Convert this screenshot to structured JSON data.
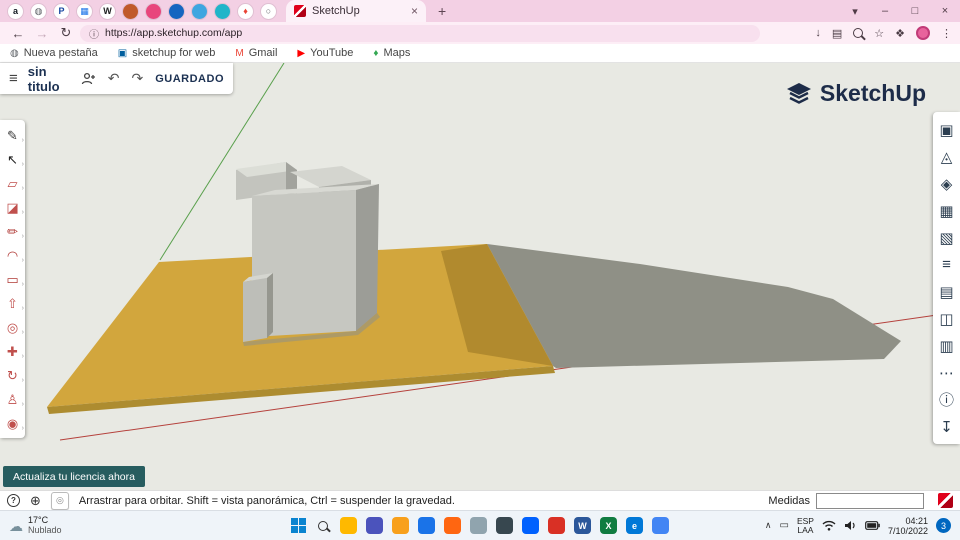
{
  "colors": {
    "canvas_bg": "#e8e9e3",
    "ground": "#d2a63d",
    "ground_edge": "#ad8c30",
    "ground_shadow": "#b18a2e",
    "cast_shadow": "#8f9086",
    "axis_green": "#59a04c",
    "axis_red": "#b5413c",
    "building_front": "#c6c7c1",
    "building_side": "#9c9d97",
    "building_top": "#d8d9d3",
    "brand_navy": "#1d2c49",
    "accent_red": "#e0001b",
    "license_teal": "#275d5f",
    "chrome_pink": "#f3d0e4"
  },
  "browser": {
    "window": {
      "tab_search": "▾",
      "minimize": "–",
      "maximize": "□",
      "close": "×"
    },
    "tabs": {
      "active_label": "SketchUp",
      "close": "×",
      "new_tab": "+"
    },
    "pinned_tabs": [
      {
        "name": "pinned-tab-amazon",
        "bg": "#ffffff",
        "fg": "#131921",
        "glyph": "a"
      },
      {
        "name": "pinned-tab-globe",
        "bg": "#ffffff",
        "fg": "#5f6368",
        "glyph": "◍"
      },
      {
        "name": "pinned-tab-paypal",
        "bg": "#ffffff",
        "fg": "#1546a0",
        "glyph": "P"
      },
      {
        "name": "pinned-tab-blue-grid",
        "bg": "#ffffff",
        "fg": "#1a73e8",
        "glyph": "▦"
      },
      {
        "name": "pinned-tab-wiki",
        "bg": "#ffffff",
        "fg": "#202122",
        "glyph": "W"
      },
      {
        "name": "pinned-tab-orange",
        "bg": "#c05a2a",
        "fg": "#ffffff",
        "glyph": ""
      },
      {
        "name": "pinned-tab-pink",
        "bg": "#e8467c",
        "fg": "#ffffff",
        "glyph": ""
      },
      {
        "name": "pinned-tab-blue-square",
        "bg": "#1565c0",
        "fg": "#ffffff",
        "glyph": ""
      },
      {
        "name": "pinned-tab-skyblue",
        "bg": "#3ea6e0",
        "fg": "#ffffff",
        "glyph": ""
      },
      {
        "name": "pinned-tab-teal",
        "bg": "#20b5c9",
        "fg": "#ffffff",
        "glyph": ""
      },
      {
        "name": "pinned-tab-maps",
        "bg": "#ffffff",
        "fg": "#ea4335",
        "glyph": "♦"
      },
      {
        "name": "pinned-tab-ring",
        "bg": "#ffffff",
        "fg": "#5f6368",
        "glyph": "○"
      }
    ],
    "address": {
      "back": "←",
      "forward": "→",
      "reload": "↻",
      "info": "ⓘ",
      "url": "https://app.sketchup.com/app",
      "install": "↓",
      "panel": "▤",
      "star": "☆",
      "puzzle": "❖",
      "menu": "⋮"
    },
    "bookmarks": [
      {
        "name": "bookmark-new-tab",
        "label": "Nueva pestaña",
        "glyph": "◍",
        "color": "#5f6368"
      },
      {
        "name": "bookmark-sketchup-web",
        "label": "sketchup for web",
        "glyph": "▣",
        "color": "#005f9e"
      },
      {
        "name": "bookmark-gmail",
        "label": "Gmail",
        "glyph": "M",
        "color": "#ea4335"
      },
      {
        "name": "bookmark-youtube",
        "label": "YouTube",
        "glyph": "▶",
        "color": "#ff0000"
      },
      {
        "name": "bookmark-maps",
        "label": "Maps",
        "glyph": "♦",
        "color": "#34a853"
      }
    ]
  },
  "app": {
    "menu_glyph": "≡",
    "title": "sin titulo",
    "undo_glyph": "↶",
    "redo_glyph": "↷",
    "saved_label": "GUARDADO",
    "brand": "SketchUp",
    "flyout_glyph": "›",
    "license_button_label": "Actualiza tu licencia ahora",
    "status_hint": "Arrastrar para orbitar. Shift = vista panorámica, Ctrl = suspender la gravedad.",
    "help_glyph": "?",
    "language_glyph": "⊕",
    "geo_glyph": "◎",
    "measures_label": "Medidas",
    "measures_value": "",
    "left_tools": [
      {
        "name": "freehand-tool",
        "glyph": "✎",
        "color": "#333333"
      },
      {
        "name": "select-tool",
        "glyph": "↖",
        "color": "#222222"
      },
      {
        "name": "eraser-tool",
        "glyph": "▱",
        "color": "#c0504d"
      },
      {
        "name": "paint-tool",
        "glyph": "◪",
        "color": "#c0504d"
      },
      {
        "name": "pencil-tool",
        "glyph": "✏",
        "color": "#b03a36"
      },
      {
        "name": "arc-tool",
        "glyph": "◠",
        "color": "#b03a36"
      },
      {
        "name": "rectangle-tool",
        "glyph": "▭",
        "color": "#b03a36"
      },
      {
        "name": "pushpull-tool",
        "glyph": "⇧",
        "color": "#c0504d"
      },
      {
        "name": "offset-tool",
        "glyph": "◎",
        "color": "#c0504d"
      },
      {
        "name": "move-tool",
        "glyph": "✚",
        "color": "#c0504d"
      },
      {
        "name": "rotate-tool",
        "glyph": "↻",
        "color": "#c0504d"
      },
      {
        "name": "walk-tool",
        "glyph": "♙",
        "color": "#c0504d"
      },
      {
        "name": "orbit-tool",
        "glyph": "◉",
        "color": "#c0504d"
      }
    ],
    "right_tools": [
      {
        "name": "entity-info-panel",
        "glyph": "▣"
      },
      {
        "name": "instructor-panel",
        "glyph": "◬"
      },
      {
        "name": "components-panel",
        "glyph": "◈"
      },
      {
        "name": "materials-panel",
        "glyph": "▦"
      },
      {
        "name": "styles-panel",
        "glyph": "▧"
      },
      {
        "name": "layers-panel",
        "glyph": "≡"
      },
      {
        "name": "scenes-panel",
        "glyph": "▤"
      },
      {
        "name": "views-panel",
        "glyph": "◫"
      },
      {
        "name": "display-panel",
        "glyph": "▥"
      },
      {
        "name": "soften-edges-panel",
        "glyph": "⋯"
      },
      {
        "name": "model-info-panel",
        "glyph": "ⓘ"
      },
      {
        "name": "download-panel",
        "glyph": "↧"
      }
    ]
  },
  "taskbar": {
    "weather": {
      "icon": "☁",
      "temp": "17°C",
      "condition": "Nublado"
    },
    "apps": [
      {
        "name": "taskbar-explorer",
        "color": "#ffb900",
        "glyph": ""
      },
      {
        "name": "taskbar-teams",
        "color": "#4b53bc",
        "glyph": ""
      },
      {
        "name": "taskbar-folder",
        "color": "#f8a01c",
        "glyph": ""
      },
      {
        "name": "taskbar-store",
        "color": "#1a73e8",
        "glyph": ""
      },
      {
        "name": "taskbar-firefox",
        "color": "#ff6611",
        "glyph": ""
      },
      {
        "name": "taskbar-widgets",
        "color": "#90a4ae",
        "glyph": ""
      },
      {
        "name": "taskbar-keyboard",
        "color": "#37474f",
        "glyph": ""
      },
      {
        "name": "taskbar-dropbox",
        "color": "#0061fe",
        "glyph": ""
      },
      {
        "name": "taskbar-media",
        "color": "#d93025",
        "glyph": ""
      },
      {
        "name": "taskbar-word",
        "color": "#2b579a",
        "glyph": "W"
      },
      {
        "name": "taskbar-excel",
        "color": "#107c41",
        "glyph": "X"
      },
      {
        "name": "taskbar-edge",
        "color": "#0078d7",
        "glyph": "e"
      },
      {
        "name": "taskbar-chrome",
        "color": "#4285f4",
        "glyph": ""
      }
    ],
    "tray": {
      "chevron": "∧",
      "monitor": "▭",
      "lang_top": "ESP",
      "lang_bottom": "LAA",
      "time": "04:21",
      "date": "7/10/2022",
      "badge": "3"
    }
  }
}
